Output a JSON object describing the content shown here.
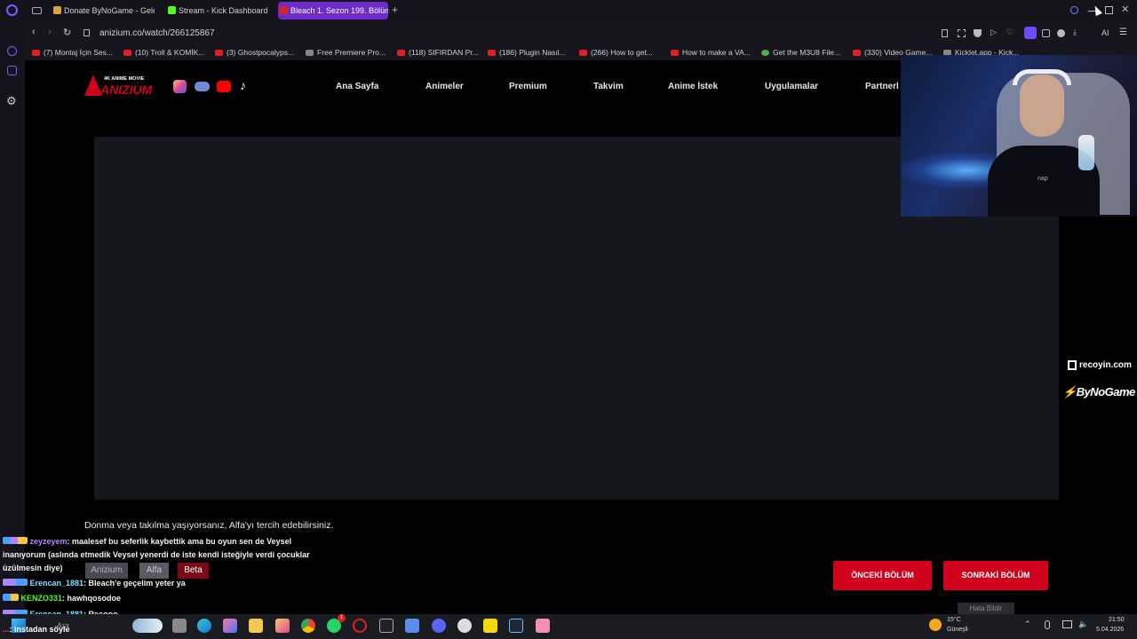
{
  "browser": {
    "tabs": [
      {
        "label": "Donate ByNoGame - Gelen",
        "icon_color": "#d9a441",
        "active": false
      },
      {
        "label": "Stream - Kick Dashboard",
        "icon_color": "#53fc18",
        "active": false
      },
      {
        "label": "Bleach 1. Sezon 199. Bölüm",
        "icon_color": "#e02020",
        "active": true
      }
    ],
    "new_tab": "+",
    "url": "anizium.co/watch/266125867",
    "toolbar_ai": "AI",
    "bookmarks": [
      "(7) Montaj İçin Ses...",
      "(10) Troll & KOMİK...",
      "(3) Ghostpocalyps...",
      "Free Premiere Pro...",
      "(118) SIFIRDAN Pr...",
      "(186) Plugin Nasıl...",
      "(266) How to get...",
      "How to make a VA...",
      "Get the M3U8 File...",
      "(330) Video Game...",
      "Kicklet.app - Kick..."
    ]
  },
  "site": {
    "logo_text": "ANIZIUM",
    "logo_tagline": "4K ANIME MOVIE",
    "social_icons": [
      "instagram-icon",
      "discord-icon",
      "youtube-icon",
      "tiktok-icon"
    ],
    "nav": [
      "Ana Sayfa",
      "Animeler",
      "Premium",
      "Takvim",
      "Anime İstek",
      "Uygulamalar",
      "Partnerl"
    ],
    "notice": "Donma veya takılma yaşıyorsanız, Alfa'yı tercih edebilirsiniz.",
    "servers": [
      "Anizium",
      "Alfa",
      "Beta"
    ],
    "prev_button": "ÖNCEKİ BÖLÜM",
    "next_button": "SONRAKİ BÖLÜM",
    "footer_partial": "Hata Bildir"
  },
  "overlay": {
    "sponsor1": "recoyin.com",
    "sponsor2": "ByNoGame",
    "cam_shirt_text": "nap"
  },
  "chat": [
    {
      "user": "zeyzeyem",
      "text": ": maalesef bu seferlik kaybettik ama bu oyun sen de Veysel"
    },
    {
      "user": "",
      "text": "inanıyorum (aslında etmedik Veysel yenerdi de iste kendi isteğiyle verdi çocuklar"
    },
    {
      "user": "",
      "text": "üzülmesin diye)"
    },
    {
      "user": "Erencan_1881",
      "text": ": Bleach'e geçelim yeter ya"
    },
    {
      "user": "KENZO331",
      "text": ": hawhqosodoe"
    },
    {
      "user": "Erencan_1881",
      "text": ": Recooo"
    },
    {
      "user": "...",
      "text": ": instadan söyle"
    }
  ],
  "taskbar": {
    "search": "Ara",
    "weather_temp": "15°C",
    "weather_desc": "Güneşli",
    "time": "21:50",
    "date": "5.04.2026",
    "notif_badge": "1"
  }
}
